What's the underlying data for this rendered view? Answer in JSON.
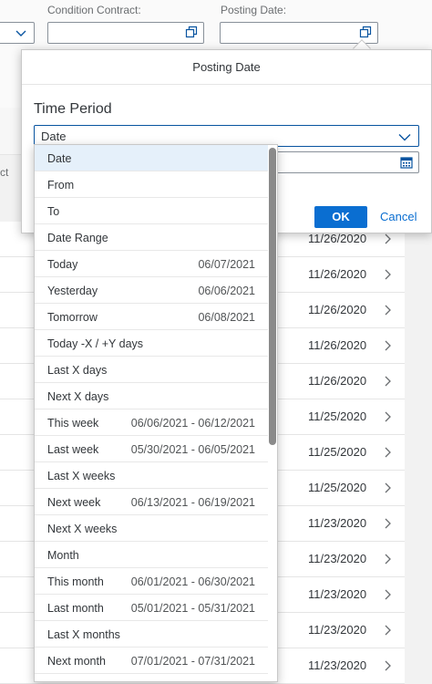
{
  "filters": {
    "condition_contract_label": "Condition Contract:",
    "condition_contract_value": "",
    "posting_date_label": "Posting Date:",
    "posting_date_value": ""
  },
  "table": {
    "partial_header": "ct",
    "rows": [
      {
        "date": "11/26/2020"
      },
      {
        "date": "11/26/2020"
      },
      {
        "date": "11/26/2020"
      },
      {
        "date": "11/26/2020"
      },
      {
        "date": "11/26/2020"
      },
      {
        "date": "11/25/2020"
      },
      {
        "date": "11/25/2020"
      },
      {
        "date": "11/25/2020"
      },
      {
        "date": "11/23/2020"
      },
      {
        "date": "11/23/2020"
      },
      {
        "date": "11/23/2020"
      },
      {
        "date": "11/23/2020"
      },
      {
        "date": "11/23/2020"
      }
    ]
  },
  "popover": {
    "header": "Posting Date",
    "section_title": "Time Period",
    "select_value": "Date",
    "date_value": "",
    "ok_label": "OK",
    "cancel_label": "Cancel"
  },
  "dropdown": {
    "options": [
      {
        "label": "Date",
        "date": "",
        "selected": true
      },
      {
        "label": "From",
        "date": ""
      },
      {
        "label": "To",
        "date": ""
      },
      {
        "label": "Date Range",
        "date": ""
      },
      {
        "label": "Today",
        "date": "06/07/2021"
      },
      {
        "label": "Yesterday",
        "date": "06/06/2021"
      },
      {
        "label": "Tomorrow",
        "date": "06/08/2021"
      },
      {
        "label": "Today -X / +Y days",
        "date": ""
      },
      {
        "label": "Last X days",
        "date": ""
      },
      {
        "label": "Next X days",
        "date": ""
      },
      {
        "label": "This week",
        "date": "06/06/2021 - 06/12/2021"
      },
      {
        "label": "Last week",
        "date": "05/30/2021 - 06/05/2021"
      },
      {
        "label": "Last X weeks",
        "date": ""
      },
      {
        "label": "Next week",
        "date": "06/13/2021 - 06/19/2021"
      },
      {
        "label": "Next X weeks",
        "date": ""
      },
      {
        "label": "Month",
        "date": ""
      },
      {
        "label": "This month",
        "date": "06/01/2021 - 06/30/2021"
      },
      {
        "label": "Last month",
        "date": "05/01/2021 - 05/31/2021"
      },
      {
        "label": "Last X months",
        "date": ""
      },
      {
        "label": "Next month",
        "date": "07/01/2021 - 07/31/2021"
      }
    ]
  },
  "colors": {
    "accent": "#0a6ed1",
    "selected_row": "#e5f0fa",
    "scrollbar": "#8a8a8a"
  }
}
